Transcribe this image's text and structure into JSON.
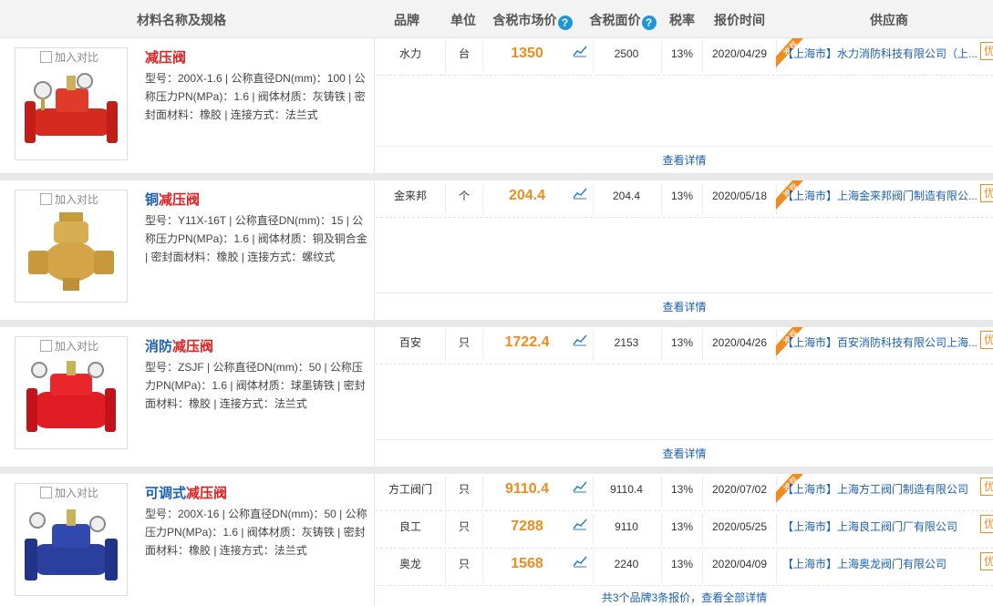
{
  "header": {
    "col_name": "材料名称及规格",
    "col_brand": "品牌",
    "col_unit": "单位",
    "col_market_price": "含税市场价",
    "col_face_price": "含税面价",
    "col_tax": "税率",
    "col_date": "报价时间",
    "col_supplier": "供应商",
    "help_icon": "?"
  },
  "common": {
    "compare_label": "加入对比",
    "recommend_badge": "推荐",
    "preferred_badge": "优",
    "detail_link": "查看详情"
  },
  "products": [
    {
      "name_prefix": "",
      "name_keyword": "减压阀",
      "spec": "型号：200X-1.6 | 公称直径DN(mm)：100 | 公称压力PN(MPa)：1.6 | 阀体材质：灰铸铁 | 密封面材料：橡胶 | 连接方式：法兰式",
      "image_icon": "red-valve-image",
      "offers": [
        {
          "brand": "水力",
          "unit": "台",
          "market_price": "1350",
          "face_price": "2500",
          "tax": "13%",
          "date": "2020/04/29",
          "supplier": "【上海市】水力消防科技有限公司（上...",
          "recommended": true
        }
      ]
    },
    {
      "name_prefix": "铜",
      "name_keyword": "减压阀",
      "spec": "型号：Y11X-16T | 公称直径DN(mm)：15 | 公称压力PN(MPa)：1.6 | 阀体材质：铜及铜合金 | 密封面材料：橡胶 | 连接方式：螺纹式",
      "image_icon": "brass-valve-image",
      "offers": [
        {
          "brand": "金来邦",
          "unit": "个",
          "market_price": "204.4",
          "face_price": "204.4",
          "tax": "13%",
          "date": "2020/05/18",
          "supplier": "【上海市】上海金来邦阀门制造有限公...",
          "recommended": true
        }
      ]
    },
    {
      "name_prefix": "消防",
      "name_keyword": "减压阀",
      "spec": "型号：ZSJF | 公称直径DN(mm)：50 | 公称压力PN(MPa)：1.6 | 阀体材质：球墨铸铁 | 密封面材料：橡胶 | 连接方式：法兰式",
      "image_icon": "red-fire-valve-image",
      "offers": [
        {
          "brand": "百安",
          "unit": "只",
          "market_price": "1722.4",
          "face_price": "2153",
          "tax": "13%",
          "date": "2020/04/26",
          "supplier": "【上海市】百安消防科技有限公司上海...",
          "recommended": true
        }
      ]
    },
    {
      "name_prefix": "可调式",
      "name_keyword": "减压阀",
      "spec": "型号：200X-16 | 公称直径DN(mm)：50 | 公称压力PN(MPa)：1.6 | 阀体材质：灰铸铁 | 密封面材料：橡胶 | 连接方式：法兰式",
      "image_icon": "blue-valve-image",
      "offers": [
        {
          "brand": "方工阀门",
          "unit": "只",
          "market_price": "9110.4",
          "face_price": "9110.4",
          "tax": "13%",
          "date": "2020/07/02",
          "supplier": "【上海市】上海方工阀门制造有限公司",
          "recommended": true
        },
        {
          "brand": "良工",
          "unit": "只",
          "market_price": "7288",
          "face_price": "9110",
          "tax": "13%",
          "date": "2020/05/25",
          "supplier": "【上海市】上海良工阀门厂有限公司",
          "recommended": false
        },
        {
          "brand": "奥龙",
          "unit": "只",
          "market_price": "1568",
          "face_price": "2240",
          "tax": "13%",
          "date": "2020/04/09",
          "supplier": "【上海市】上海奥龙阀门有限公司",
          "recommended": false
        }
      ],
      "more_link": "共3个品牌3条报价，查看全部详情"
    }
  ],
  "colors": {
    "price": "#f08c1e",
    "link": "#1a5fb4",
    "keyword": "#e02020"
  }
}
